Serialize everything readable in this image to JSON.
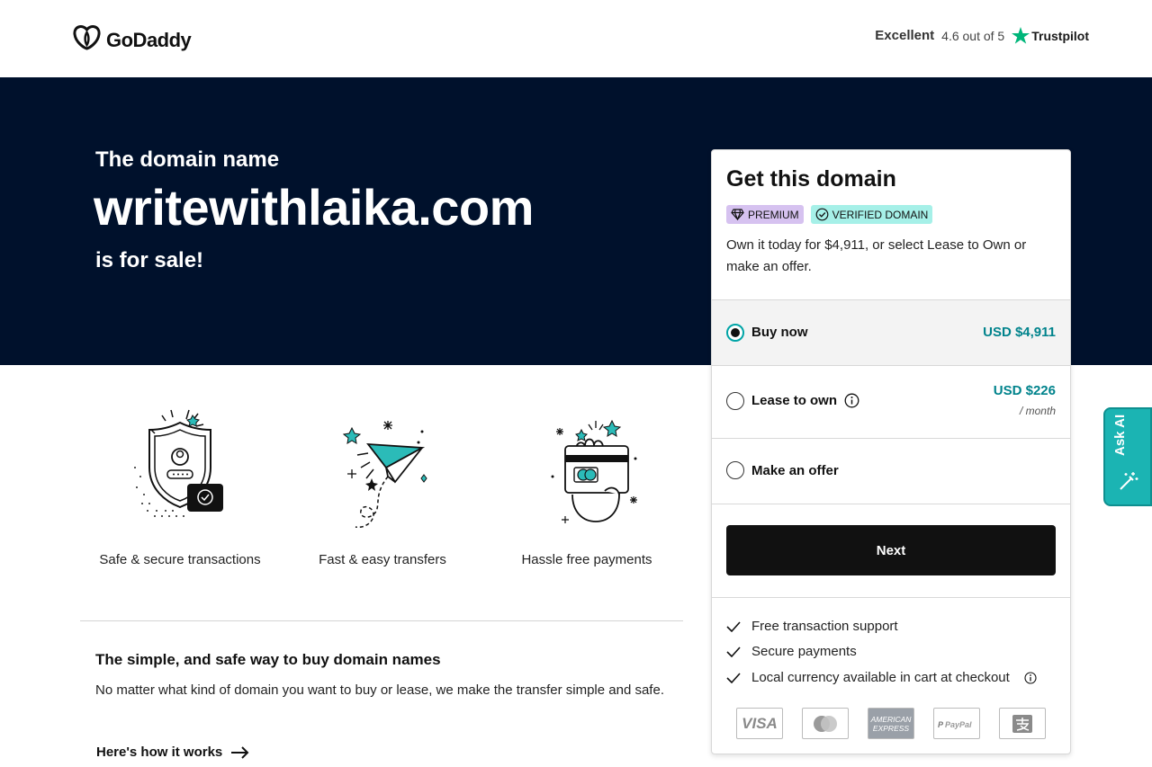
{
  "header": {
    "brand": "GoDaddy",
    "trust_excellent": "Excellent",
    "trust_rating": "4.6 out of 5",
    "trust_brand": "Trustpilot"
  },
  "hero": {
    "pre": "The domain name",
    "domain": "writewithlaika.com",
    "post": "is for sale!"
  },
  "features": [
    {
      "label": "Safe & secure transactions",
      "icon": "shield-icon"
    },
    {
      "label": "Fast & easy transfers",
      "icon": "paper-plane-icon"
    },
    {
      "label": "Hassle free payments",
      "icon": "card-in-hand-icon"
    }
  ],
  "info": {
    "title": "The simple, and safe way to buy domain names",
    "text": "No matter what kind of domain you want to buy or lease, we make the transfer simple and safe.",
    "link": "Here's how it works"
  },
  "card": {
    "title": "Get this domain",
    "badge_premium": "PREMIUM",
    "badge_verified": "VERIFIED DOMAIN",
    "description": "Own it today for $4,911, or select Lease to Own or make an offer.",
    "options": [
      {
        "label": "Buy now",
        "price": "USD $4,911",
        "selected": true
      },
      {
        "label": "Lease to own",
        "price": "USD $226",
        "sub": "/ month",
        "selected": false
      },
      {
        "label": "Make an offer",
        "selected": false
      }
    ],
    "next_label": "Next",
    "benefits": [
      "Free transaction support",
      "Secure payments",
      "Local currency available in cart at checkout"
    ],
    "payments": [
      "VISA",
      "Mastercard",
      "American Express",
      "PayPal",
      "Alipay"
    ]
  },
  "ask_ai": "Ask AI",
  "colors": {
    "hero_bg": "#00112c",
    "accent_teal": "#00838c",
    "ask_ai": "#1bb4b3",
    "premium_badge": "#d6c2f0",
    "verified_badge": "#a6f0e8"
  }
}
